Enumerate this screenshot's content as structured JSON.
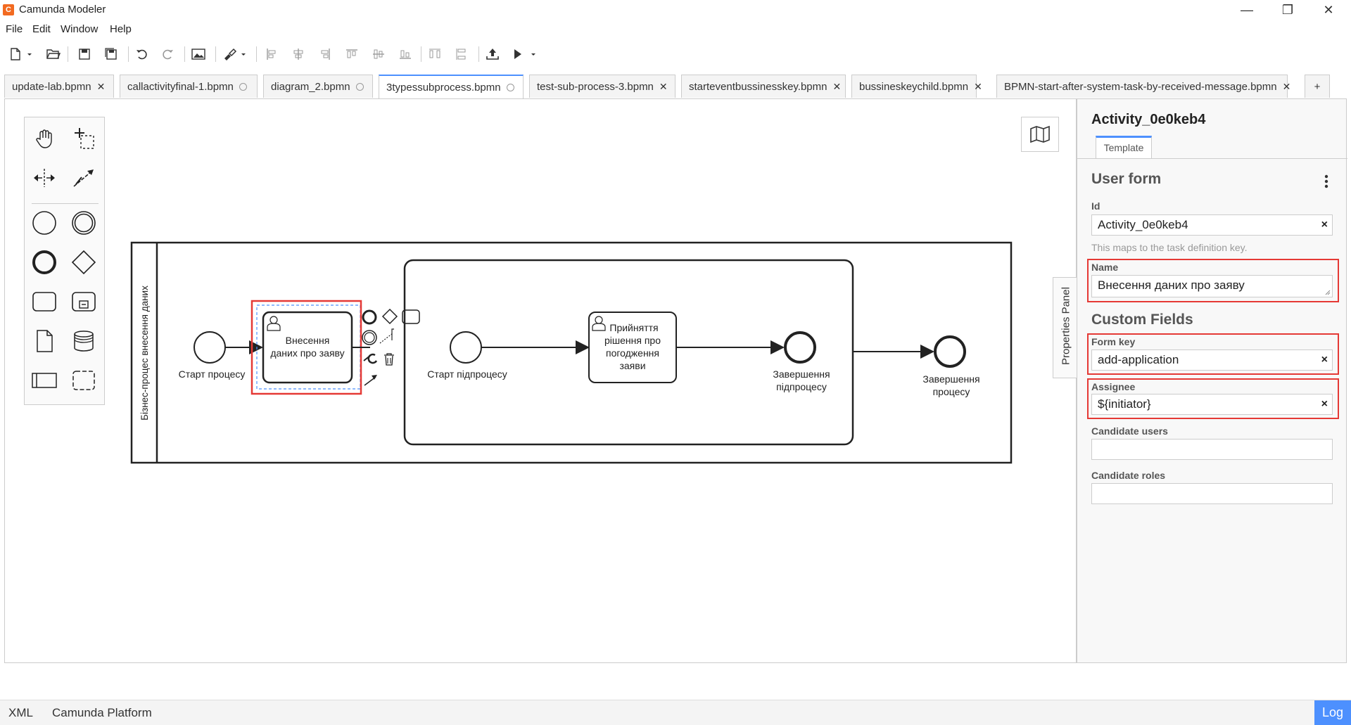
{
  "window": {
    "title": "Camunda Modeler",
    "minimize": "—",
    "restore": "❐",
    "close": "✕"
  },
  "menu": [
    "File",
    "Edit",
    "Window",
    "Help"
  ],
  "tabs": [
    {
      "label": "update-lab.bpmn",
      "state": "close"
    },
    {
      "label": "callactivityfinal-1.bpmn",
      "state": "dot"
    },
    {
      "label": "diagram_2.bpmn",
      "state": "dot"
    },
    {
      "label": "3typessubprocess.bpmn",
      "state": "dot",
      "active": true
    },
    {
      "label": "test-sub-process-3.bpmn",
      "state": "close"
    },
    {
      "label": "starteventbussinesskey.bpmn",
      "state": "close"
    },
    {
      "label": "bussineskeychild.bpmn",
      "state": "close"
    },
    {
      "label": "BPMN-start-after-system-task-by-received-message.bpmn",
      "state": "close"
    }
  ],
  "tab_close_glyph": "✕",
  "tab_add": "+",
  "diagram": {
    "pool_label": "Бізнес-процес внесення даних",
    "start_event": "Старт процесу",
    "task1": [
      "Внесення",
      "даних про заяву"
    ],
    "sub_start": "Старт підпроцесу",
    "task2": [
      "Прийняття",
      "рішення про",
      "погодження",
      "заяви"
    ],
    "sub_end": [
      "Завершення",
      "підпроцесу"
    ],
    "end_event": [
      "Завершення",
      "процесу"
    ]
  },
  "properties_toggle": "Properties Panel",
  "panel": {
    "title": "Activity_0e0keb4",
    "tab": "Template",
    "section_user_form": "User form",
    "id_label": "Id",
    "id_value": "Activity_0e0keb4",
    "id_hint": "This maps to the task definition key.",
    "name_label": "Name",
    "name_value": "Внесення даних про заяву",
    "section_custom": "Custom Fields",
    "form_key_label": "Form key",
    "form_key_value": "add-application",
    "assignee_label": "Assignee",
    "assignee_value": "${initiator}",
    "candidate_users_label": "Candidate users",
    "candidate_roles_label": "Candidate roles",
    "clear_glyph": "×"
  },
  "status": {
    "xml": "XML",
    "platform": "Camunda Platform",
    "log": "Log"
  },
  "colors": {
    "accent": "#4d90fe",
    "highlight": "#e53935",
    "brand": "#f26a21"
  }
}
